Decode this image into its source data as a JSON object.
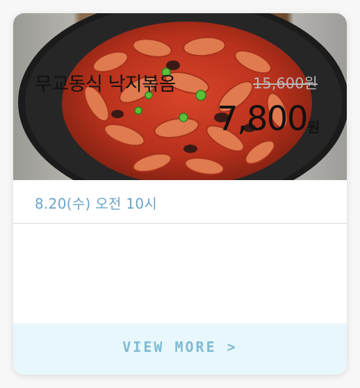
{
  "card": {
    "image_alt": "spicy stir-fried octopus in black pan",
    "date_text": "8.20(수) 오전 10시",
    "product_name": "무교동식 낙지볶음",
    "original_price": "15,600원",
    "sale_price": "7,800",
    "currency": "원",
    "cta_label": "VIEW MORE >"
  },
  "colors": {
    "date": "#6aa3c9",
    "cta": "#7fbad0",
    "footer_bg": "#e8f7fb"
  }
}
